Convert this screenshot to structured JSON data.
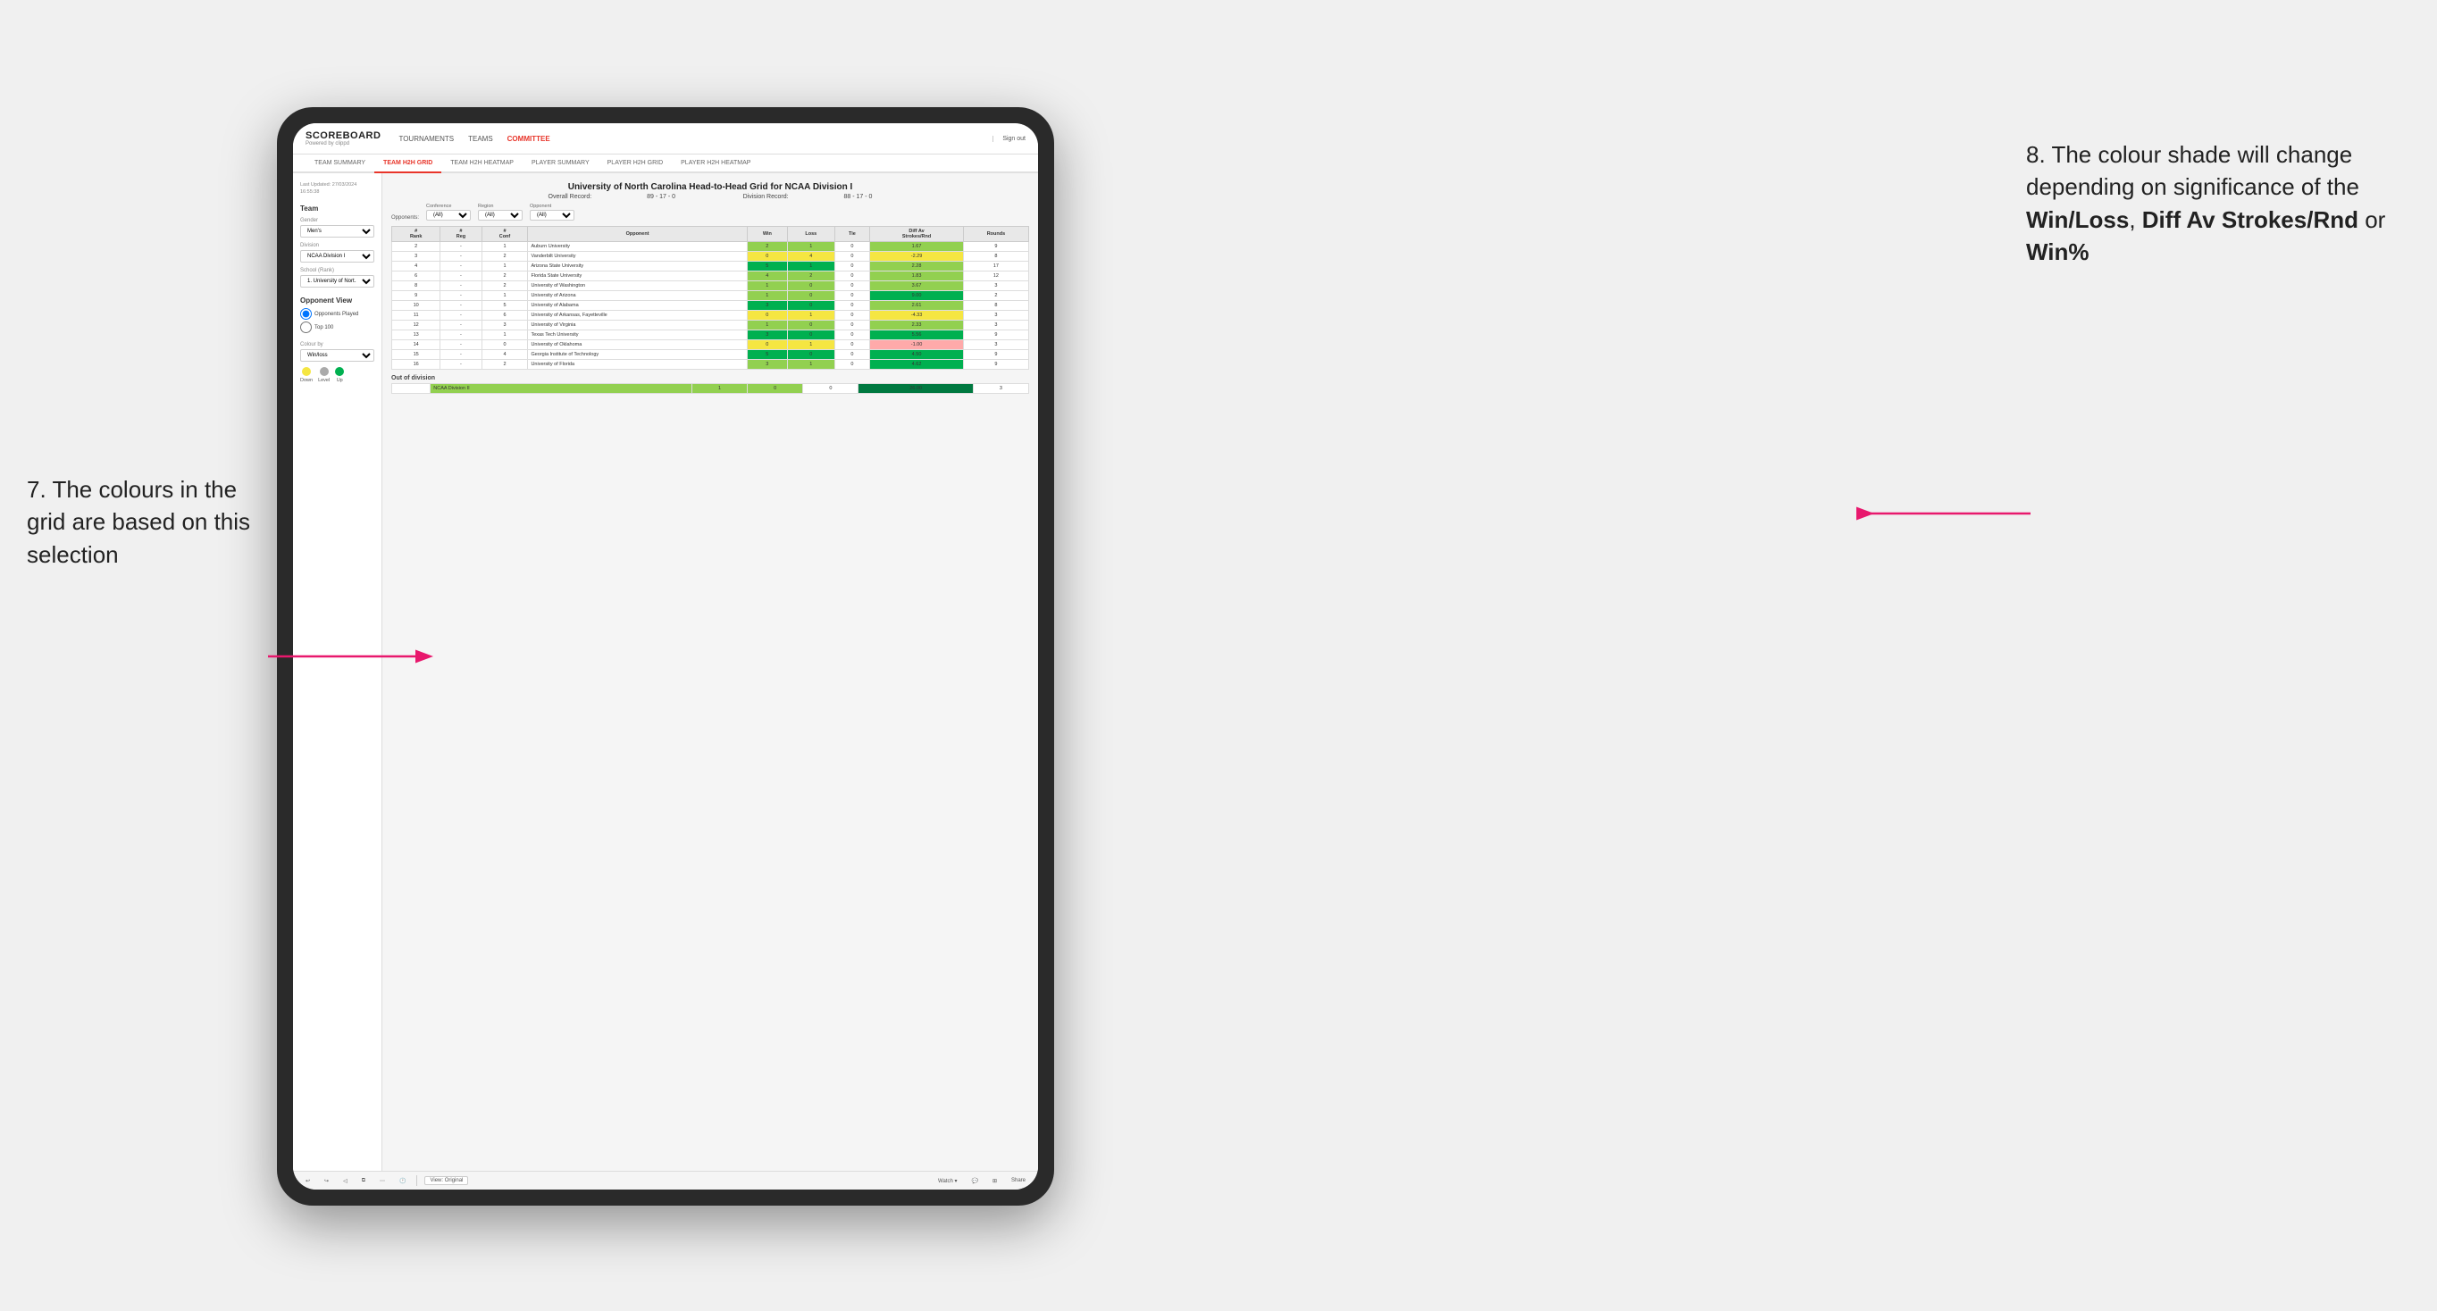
{
  "annotations": {
    "left_text": "7. The colours in the grid are based on this selection",
    "right_title": "8. The colour shade will change depending on significance of the ",
    "right_bold1": "Win/Loss",
    "right_comma": ", ",
    "right_bold2": "Diff Av Strokes/Rnd",
    "right_or": " or",
    "right_bold3": "Win%"
  },
  "nav": {
    "logo": "SCOREBOARD",
    "logo_sub": "Powered by clippd",
    "links": [
      "TOURNAMENTS",
      "TEAMS",
      "COMMITTEE"
    ],
    "sign_out": "Sign out",
    "active_link": "COMMITTEE"
  },
  "sub_nav": {
    "items": [
      "TEAM SUMMARY",
      "TEAM H2H GRID",
      "TEAM H2H HEATMAP",
      "PLAYER SUMMARY",
      "PLAYER H2H GRID",
      "PLAYER H2H HEATMAP"
    ],
    "active": "TEAM H2H GRID"
  },
  "sidebar": {
    "timestamp": "Last Updated: 27/03/2024\n16:55:38",
    "team_section": "Team",
    "gender_label": "Gender",
    "gender_value": "Men's",
    "division_label": "Division",
    "division_value": "NCAA Division I",
    "school_label": "School (Rank)",
    "school_value": "1. University of Nort...",
    "opponent_view_label": "Opponent View",
    "radio1": "Opponents Played",
    "radio2": "Top 100",
    "colour_by_label": "Colour by",
    "colour_by_value": "Win/loss",
    "legend": {
      "down": "Down",
      "level": "Level",
      "up": "Up"
    }
  },
  "grid": {
    "title": "University of North Carolina Head-to-Head Grid for NCAA Division I",
    "overall_record_label": "Overall Record:",
    "overall_record": "89 - 17 - 0",
    "division_record_label": "Division Record:",
    "division_record": "88 - 17 - 0",
    "filters": {
      "opponents_label": "Opponents:",
      "opponents_value": "(All)",
      "conference_label": "Conference",
      "conference_value": "(All)",
      "region_label": "Region",
      "region_value": "(All)",
      "opponent_label": "Opponent",
      "opponent_value": "(All)"
    },
    "columns": [
      "#\nRank",
      "#\nReg",
      "#\nConf",
      "Opponent",
      "Win",
      "Loss",
      "Tie",
      "Diff Av\nStrokes/Rnd",
      "Rounds"
    ],
    "rows": [
      {
        "rank": "2",
        "reg": "-",
        "conf": "1",
        "opponent": "Auburn University",
        "win": "2",
        "loss": "1",
        "tie": "0",
        "diff": "1.67",
        "rounds": "9",
        "win_color": "light-green",
        "diff_color": "light-green"
      },
      {
        "rank": "3",
        "reg": "-",
        "conf": "2",
        "opponent": "Vanderbilt University",
        "win": "0",
        "loss": "4",
        "tie": "0",
        "diff": "-2.29",
        "rounds": "8",
        "win_color": "yellow",
        "diff_color": "yellow"
      },
      {
        "rank": "4",
        "reg": "-",
        "conf": "1",
        "opponent": "Arizona State University",
        "win": "5",
        "loss": "1",
        "tie": "0",
        "diff": "2.28",
        "rounds": "17",
        "win_color": "green",
        "diff_color": "light-green"
      },
      {
        "rank": "6",
        "reg": "-",
        "conf": "2",
        "opponent": "Florida State University",
        "win": "4",
        "loss": "2",
        "tie": "0",
        "diff": "1.83",
        "rounds": "12",
        "win_color": "light-green",
        "diff_color": "light-green"
      },
      {
        "rank": "8",
        "reg": "-",
        "conf": "2",
        "opponent": "University of Washington",
        "win": "1",
        "loss": "0",
        "tie": "0",
        "diff": "3.67",
        "rounds": "3",
        "win_color": "light-green",
        "diff_color": "light-green"
      },
      {
        "rank": "9",
        "reg": "-",
        "conf": "1",
        "opponent": "University of Arizona",
        "win": "1",
        "loss": "0",
        "tie": "0",
        "diff": "9.00",
        "rounds": "2",
        "win_color": "light-green",
        "diff_color": "green"
      },
      {
        "rank": "10",
        "reg": "-",
        "conf": "5",
        "opponent": "University of Alabama",
        "win": "3",
        "loss": "0",
        "tie": "0",
        "diff": "2.61",
        "rounds": "8",
        "win_color": "green",
        "diff_color": "light-green"
      },
      {
        "rank": "11",
        "reg": "-",
        "conf": "6",
        "opponent": "University of Arkansas, Fayetteville",
        "win": "0",
        "loss": "1",
        "tie": "0",
        "diff": "-4.33",
        "rounds": "3",
        "win_color": "yellow",
        "diff_color": "yellow"
      },
      {
        "rank": "12",
        "reg": "-",
        "conf": "3",
        "opponent": "University of Virginia",
        "win": "1",
        "loss": "0",
        "tie": "0",
        "diff": "2.33",
        "rounds": "3",
        "win_color": "light-green",
        "diff_color": "light-green"
      },
      {
        "rank": "13",
        "reg": "-",
        "conf": "1",
        "opponent": "Texas Tech University",
        "win": "3",
        "loss": "0",
        "tie": "0",
        "diff": "5.56",
        "rounds": "9",
        "win_color": "green",
        "diff_color": "green"
      },
      {
        "rank": "14",
        "reg": "-",
        "conf": "0",
        "opponent": "University of Oklahoma",
        "win": "0",
        "loss": "1",
        "tie": "0",
        "diff": "-1.00",
        "rounds": "3",
        "win_color": "yellow",
        "diff_color": "light-red"
      },
      {
        "rank": "15",
        "reg": "-",
        "conf": "4",
        "opponent": "Georgia Institute of Technology",
        "win": "5",
        "loss": "0",
        "tie": "0",
        "diff": "4.50",
        "rounds": "9",
        "win_color": "green",
        "diff_color": "green"
      },
      {
        "rank": "16",
        "reg": "-",
        "conf": "2",
        "opponent": "University of Florida",
        "win": "3",
        "loss": "1",
        "tie": "0",
        "diff": "4.62",
        "rounds": "9",
        "win_color": "light-green",
        "diff_color": "green"
      }
    ],
    "out_of_division_label": "Out of division",
    "out_of_division_rows": [
      {
        "opponent": "NCAA Division II",
        "win": "1",
        "loss": "0",
        "tie": "0",
        "diff": "26.00",
        "rounds": "3",
        "win_color": "light-green",
        "diff_color": "dark-green"
      }
    ]
  },
  "toolbar": {
    "view_label": "View: Original",
    "watch": "Watch ▾",
    "share": "Share"
  }
}
